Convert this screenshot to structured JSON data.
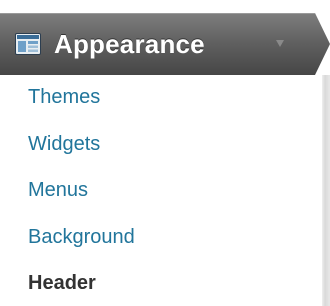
{
  "header": {
    "title": "Appearance",
    "icon": "appearance-icon",
    "caret_icon": "caret-down-icon",
    "gradient_top": "#7a7a7a",
    "gradient_bottom": "#484848"
  },
  "submenu": {
    "items": [
      {
        "label": "Themes",
        "current": false
      },
      {
        "label": "Widgets",
        "current": false
      },
      {
        "label": "Menus",
        "current": false
      },
      {
        "label": "Background",
        "current": false
      },
      {
        "label": "Header",
        "current": true
      }
    ],
    "link_color": "#21759b",
    "current_color": "#333333"
  }
}
